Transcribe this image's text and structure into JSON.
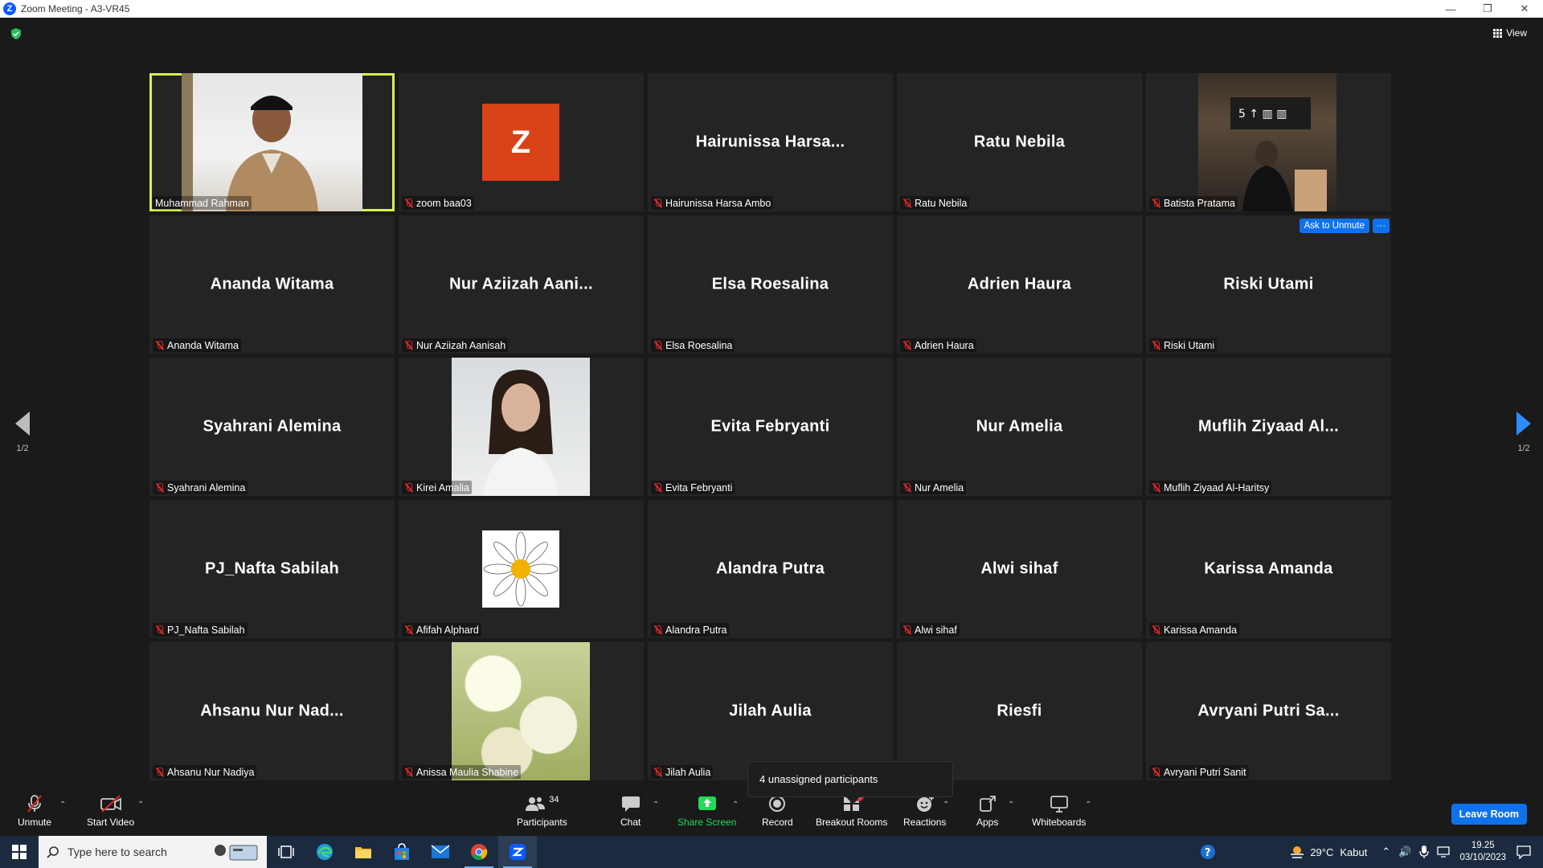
{
  "window": {
    "title": "Zoom Meeting - A3-VR45",
    "logo": "Z"
  },
  "meeting": {
    "view_label": "View",
    "page_left": "1/2",
    "page_right": "1/2",
    "ask_to_unmute": "Ask to Unmute",
    "more": "···",
    "tooltip": "4 unassigned participants",
    "avatar_letter": "Z"
  },
  "tiles": [
    {
      "display": "",
      "label": "Muhammad Rahman"
    },
    {
      "display": "",
      "label": "zoom baa03"
    },
    {
      "display": "Hairunissa  Harsa...",
      "label": "Hairunissa Harsa Ambo"
    },
    {
      "display": "Ratu Nebila",
      "label": "Ratu Nebila"
    },
    {
      "display": "",
      "label": "Batista Pratama"
    },
    {
      "display": "Ananda Witama",
      "label": "Ananda Witama"
    },
    {
      "display": "Nur  Aziizah  Aani...",
      "label": "Nur Aziizah Aanisah"
    },
    {
      "display": "Elsa Roesalina",
      "label": "Elsa Roesalina"
    },
    {
      "display": "Adrien Haura",
      "label": "Adrien Haura"
    },
    {
      "display": "Riski Utami",
      "label": "Riski Utami"
    },
    {
      "display": "Syahrani Alemina",
      "label": "Syahrani Alemina"
    },
    {
      "display": "",
      "label": "Kirei Amalia"
    },
    {
      "display": "Evita Febryanti",
      "label": "Evita Febryanti"
    },
    {
      "display": "Nur Amelia",
      "label": "Nur Amelia"
    },
    {
      "display": "Muflih  Ziyaad  Al...",
      "label": "Muflih Ziyaad Al-Haritsy"
    },
    {
      "display": "PJ_Nafta Sabilah",
      "label": "PJ_Nafta Sabilah"
    },
    {
      "display": "",
      "label": "Afifah Alphard"
    },
    {
      "display": "Alandra Putra",
      "label": "Alandra Putra"
    },
    {
      "display": "Alwi sihaf",
      "label": "Alwi sihaf"
    },
    {
      "display": "Karissa Amanda",
      "label": "Karissa Amanda"
    },
    {
      "display": "Ahsanu Nur Nad...",
      "label": "Ahsanu Nur Nadiya"
    },
    {
      "display": "",
      "label": "Anissa Maulia Shabine"
    },
    {
      "display": "Jilah Aulia",
      "label": "Jilah Aulia"
    },
    {
      "display": "Riesfi",
      "label": ""
    },
    {
      "display": "Avryani Putri Sa...",
      "label": "Avryani Putri Sanit"
    }
  ],
  "toolbar": {
    "unmute": "Unmute",
    "start_video": "Start Video",
    "participants": "Participants",
    "participants_count": "34",
    "chat": "Chat",
    "share_screen": "Share Screen",
    "record": "Record",
    "breakout_rooms": "Breakout Rooms",
    "breakout_badge": "4",
    "reactions": "Reactions",
    "apps": "Apps",
    "whiteboards": "Whiteboards",
    "leave_room": "Leave Room",
    "caret": "⌃"
  },
  "taskbar": {
    "search_placeholder": "Type here to search",
    "weather_temp": "29°C",
    "weather_desc": "Kabut",
    "time": "19.25",
    "date": "03/10/2023"
  },
  "colors": {
    "accent": "#0e72ed",
    "active_speaker": "#d8f052",
    "share_green": "#23d959",
    "muted_red": "#e02828"
  }
}
